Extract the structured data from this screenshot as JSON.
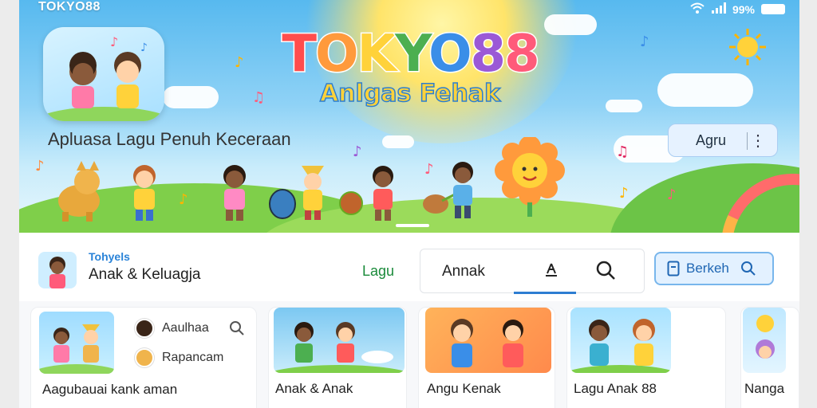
{
  "status_bar": {
    "brand": "TOKYO88",
    "battery": "99%"
  },
  "banner": {
    "logo_main": "TOKYO88",
    "logo_sub": "Anlgas Fehak",
    "tagline": "Apluasa Lagu Penuh Keceraan",
    "menu_button": "Agru"
  },
  "topbar": {
    "channel_name": "Tohyels",
    "channel_sub": "Anak & Keluagja",
    "tab_lagu": "Lagu",
    "tab_anak": "Annak",
    "search_button": "Berkeh"
  },
  "cards": [
    {
      "title": "Aagubauai kank aman",
      "items": [
        "Aaulhaa",
        "Rapancam"
      ]
    },
    {
      "title": "Anak & Anak"
    },
    {
      "title": "Angu Kenak"
    },
    {
      "title": "Lagu Anak 88"
    },
    {
      "title": "Nanga"
    }
  ],
  "colors": {
    "accent": "#2d7dd2",
    "sky": "#57b9ef",
    "grass": "#7fcf4a",
    "logo_yellow": "#ffd23a"
  }
}
